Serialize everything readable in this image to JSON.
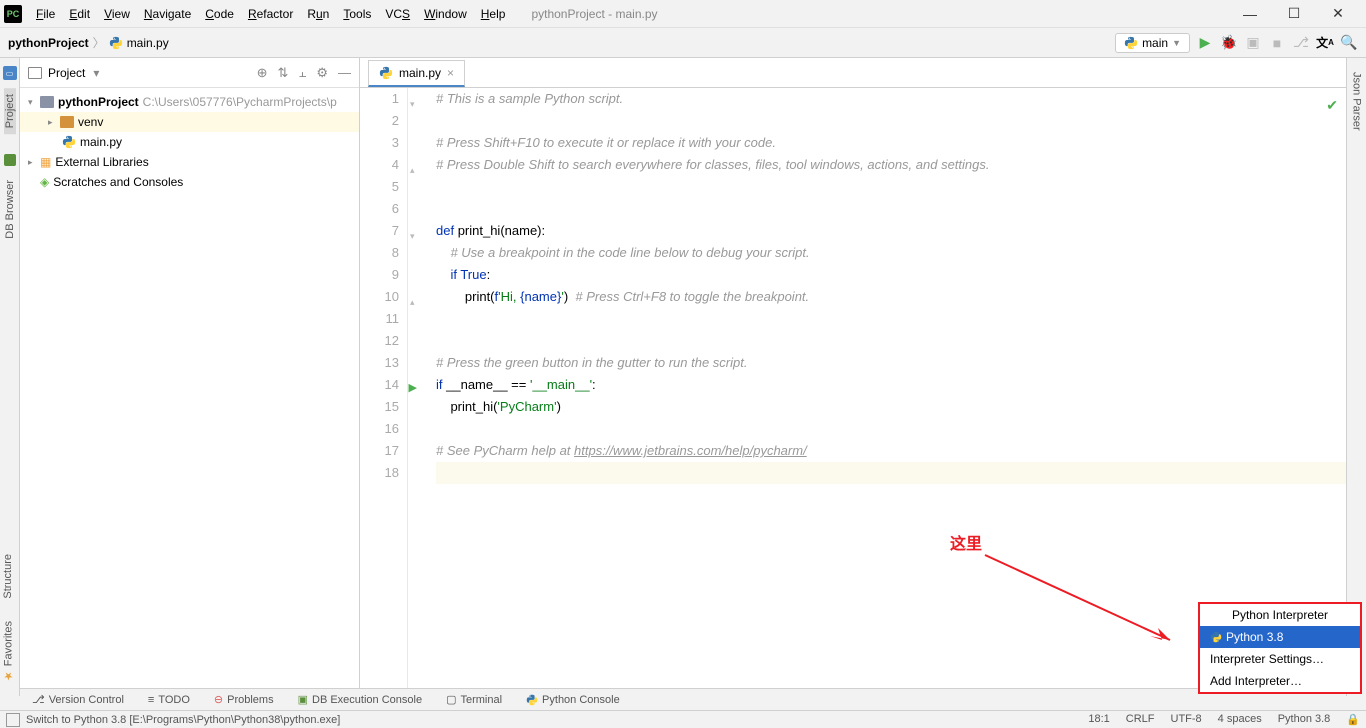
{
  "window": {
    "title": "pythonProject - main.py",
    "minimize": "—",
    "maximize": "☐",
    "close": "✕"
  },
  "menu": {
    "file": "File",
    "edit": "Edit",
    "view": "View",
    "navigate": "Navigate",
    "code": "Code",
    "refactor": "Refactor",
    "run": "Run",
    "tools": "Tools",
    "vcs": "VCS",
    "window": "Window",
    "help": "Help"
  },
  "breadcrumb": {
    "project": "pythonProject",
    "file": "main.py"
  },
  "toolbar": {
    "run_config": "main"
  },
  "project_panel": {
    "title": "Project",
    "root": "pythonProject",
    "root_path": "C:\\Users\\057776\\PycharmProjects\\p",
    "venv": "venv",
    "mainpy": "main.py",
    "ext_libs": "External Libraries",
    "scratches": "Scratches and Consoles"
  },
  "tabs": {
    "main": "main.py"
  },
  "code": {
    "l1": "# This is a sample Python script.",
    "l3": "# Press Shift+F10 to execute it or replace it with your code.",
    "l4": "# Press Double Shift to search everywhere for classes, files, tool windows, actions, and settings.",
    "l7_def": "def ",
    "l7_name": "print_hi(name):",
    "l8": "    # Use a breakpoint in the code line below to debug your script.",
    "l9_if": "    if ",
    "l9_true": "True",
    "l9_colon": ":",
    "l10_print": "        print(",
    "l10_f": "f",
    "l10_str1": "'Hi, ",
    "l10_brace": "{name}",
    "l10_str2": "'",
    "l10_close": ")",
    "l10_comment": "  # Press Ctrl+F8 to toggle the breakpoint.",
    "l13": "# Press the green button in the gutter to run the script.",
    "l14_if": "if ",
    "l14_name": "__name__ == ",
    "l14_str": "'__main__'",
    "l14_colon": ":",
    "l15_call": "    print_hi(",
    "l15_str": "'PyCharm'",
    "l15_close": ")",
    "l17_pre": "# See PyCharm help at ",
    "l17_link": "https://www.jetbrains.com/help/pycharm/"
  },
  "annotation": "这里",
  "popup": {
    "header": "Python Interpreter",
    "selected": "Python 3.8",
    "settings": "Interpreter Settings…",
    "add": "Add Interpreter…"
  },
  "bottom_tabs": {
    "version_control": "Version Control",
    "todo": "TODO",
    "problems": "Problems",
    "db_exec": "DB Execution Console",
    "terminal": "Terminal",
    "python_console": "Python Console"
  },
  "right_stripe": {
    "json_parser": "Json Parser"
  },
  "left_stripe": {
    "project": "Project",
    "db_browser": "DB Browser"
  },
  "left_bottom": {
    "structure": "Structure",
    "favorites": "Favorites"
  },
  "statusbar": {
    "message": "Switch to Python 3.8 [E:\\Programs\\Python\\Python38\\python.exe]",
    "pos": "18:1",
    "crlf": "CRLF",
    "enc": "UTF-8",
    "indent": "4 spaces",
    "interp": "Python 3.8"
  }
}
